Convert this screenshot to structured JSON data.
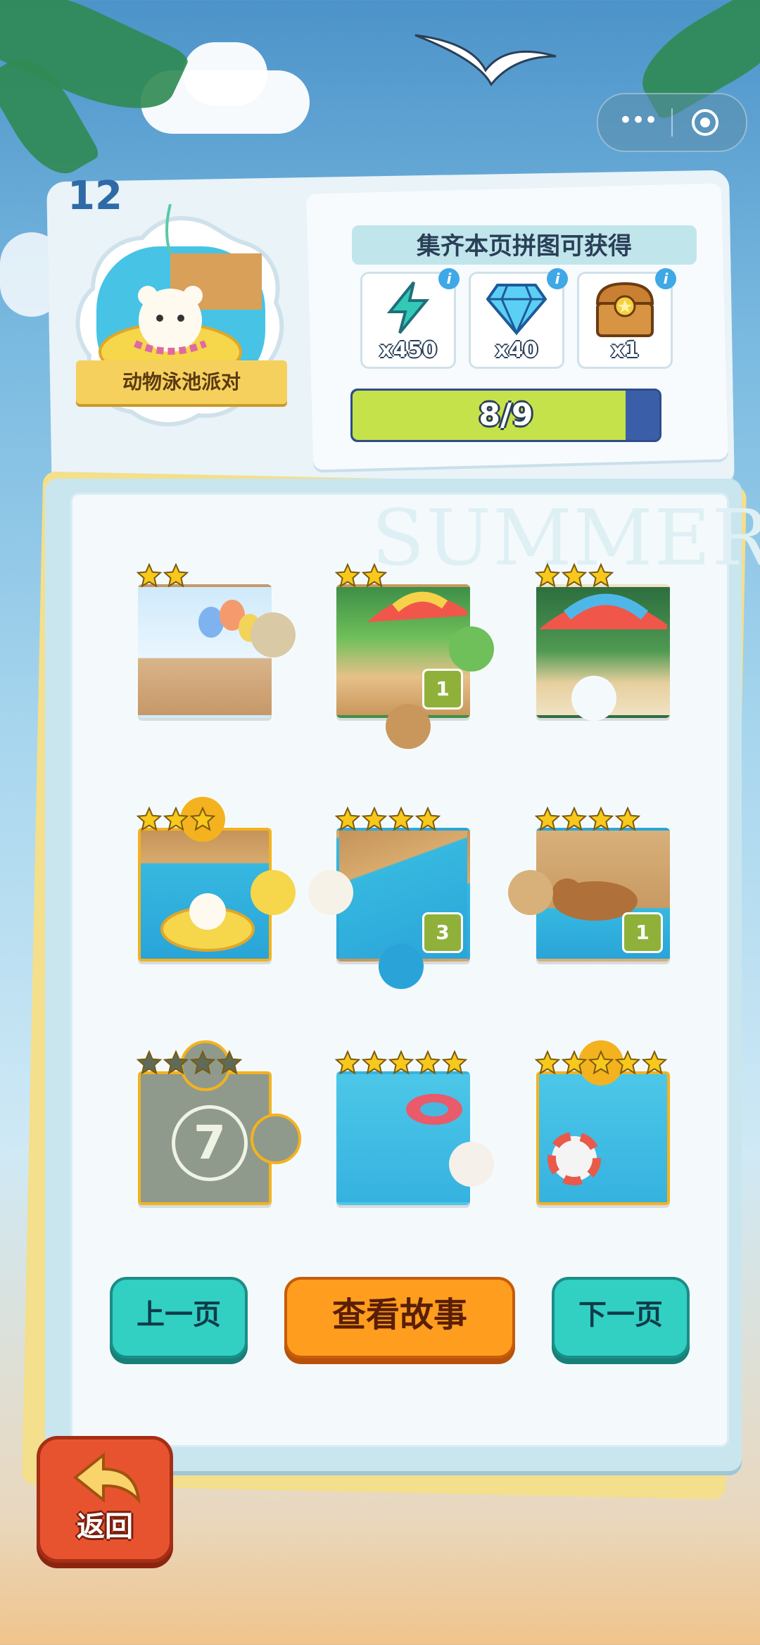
{
  "header": {
    "page_number": "12",
    "badge_title": "动物泳池派对",
    "reward_title": "集齐本页拼图可获得",
    "rewards": [
      {
        "icon": "lightning-icon",
        "amount": "x450"
      },
      {
        "icon": "diamond-icon",
        "amount": "x40"
      },
      {
        "icon": "treasure-chest-icon",
        "amount": "x1"
      }
    ],
    "progress": {
      "text": "8/9",
      "collected": 8,
      "total": 9
    }
  },
  "album": {
    "watermark": "SUMMER",
    "pieces": [
      {
        "stars": 2,
        "count": "",
        "locked": false
      },
      {
        "stars": 2,
        "count": "1",
        "locked": false
      },
      {
        "stars": 3,
        "count": "",
        "locked": false
      },
      {
        "stars": 3,
        "count": "",
        "locked": false
      },
      {
        "stars": 4,
        "count": "3",
        "locked": false
      },
      {
        "stars": 4,
        "count": "1",
        "locked": false
      },
      {
        "stars": 4,
        "count": "",
        "locked": true,
        "label": "7"
      },
      {
        "stars": 5,
        "count": "",
        "locked": false
      },
      {
        "stars": 5,
        "count": "",
        "locked": false
      }
    ]
  },
  "buttons": {
    "prev": "上一页",
    "story": "查看故事",
    "next": "下一页",
    "back": "返回"
  },
  "colors": {
    "star_gold": "#f8c81c",
    "star_grey": "#5d6b58",
    "progress_fill": "#c6e24a",
    "button_teal": "#31d0c2",
    "button_orange": "#ff9d1f",
    "back_red": "#e8532f"
  }
}
